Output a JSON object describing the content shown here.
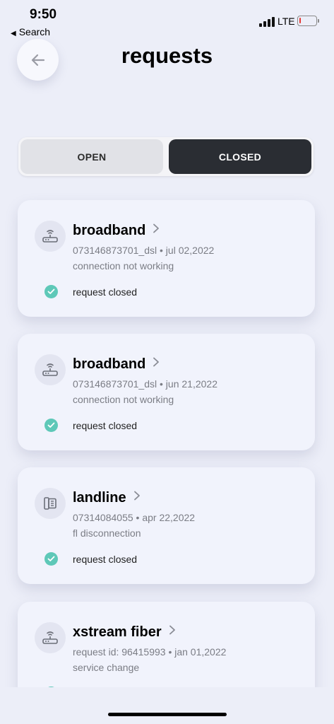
{
  "status_bar": {
    "time": "9:50",
    "back_app": "Search",
    "network": "LTE",
    "battery_level": 0.08
  },
  "header": {
    "title": "requests",
    "back_icon": "arrow-left-icon"
  },
  "tabs": [
    {
      "label": "OPEN",
      "active": false
    },
    {
      "label": "CLOSED",
      "active": true
    }
  ],
  "colors": {
    "background": "#eceef8",
    "active_tab": "#2a2d33",
    "status_check": "#5ec8b8"
  },
  "requests": [
    {
      "icon": "router-icon",
      "title": "broadband",
      "meta": "073146873701_dsl • jul 02,2022",
      "description": "connection not working",
      "status": "request closed"
    },
    {
      "icon": "router-icon",
      "title": "broadband",
      "meta": "073146873701_dsl • jun 21,2022",
      "description": "connection not working",
      "status": "request closed"
    },
    {
      "icon": "landline-phone-icon",
      "title": "landline",
      "meta": "07314084055 • apr 22,2022",
      "description": "fl disconnection",
      "status": "request closed"
    },
    {
      "icon": "router-icon",
      "title": "xstream fiber",
      "meta": "request id: 96415993 • jan 01,2022",
      "description": "service change",
      "status": ""
    }
  ]
}
